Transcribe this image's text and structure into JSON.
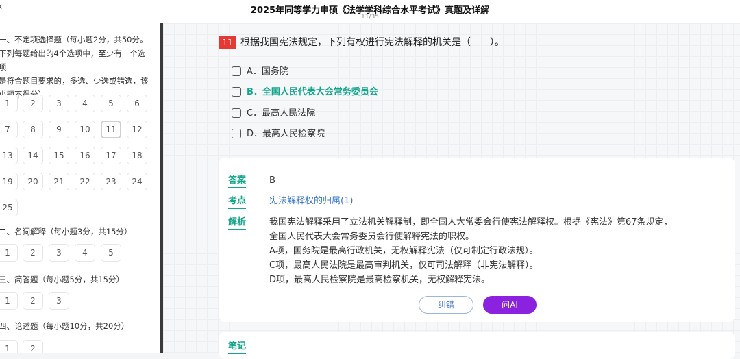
{
  "header": {
    "title": "2025年同等学力申硕《法学学科综合水平考试》真题及详解",
    "page": "11/35",
    "back_icon": "back-icon"
  },
  "sidebar": {
    "sections": [
      {
        "title": "一、不定项选择题（每小题2分，共50分。",
        "desc1": "下列每题给出的4个选项中，至少有一个选项",
        "desc2": "是符合题目要求的，多选、少选或错选，该",
        "desc3": "小题不得分）",
        "items": [
          "1",
          "2",
          "3",
          "4",
          "5",
          "6",
          "7",
          "8",
          "9",
          "10",
          "11",
          "12",
          "13",
          "14",
          "15",
          "16",
          "17",
          "18",
          "19",
          "20",
          "21",
          "22",
          "23",
          "24",
          "25"
        ]
      },
      {
        "title": "二、名词解释（每小题3分，共15分）",
        "items": [
          "1",
          "2",
          "3",
          "4",
          "5"
        ]
      },
      {
        "title": "三、简答题（每小题5分，共15分）",
        "items": [
          "1",
          "2",
          "3"
        ]
      },
      {
        "title": "四、论述题（每小题10分，共20分）",
        "items": [
          "1",
          "2"
        ]
      }
    ],
    "active_item": "11"
  },
  "question": {
    "number": "11",
    "text": "根据我国宪法规定，下列有权进行宪法解释的机关是（　　）。",
    "options": [
      {
        "label": "A．国务院",
        "correct": false
      },
      {
        "label": "B．全国人民代表大会常务委员会",
        "correct": true
      },
      {
        "label": "C．最高人民法院",
        "correct": false
      },
      {
        "label": "D．最高人民检察院",
        "correct": false
      }
    ]
  },
  "answer": {
    "answer_label": "答案",
    "answer_value": "B",
    "point_label": "考点",
    "point_value": "宪法解释权的归属(1)",
    "analysis_label": "解析",
    "analysis_lines": [
      "我国宪法解释采用了立法机关解释制，即全国人大常委会行使宪法解释权。根据《宪法》第67条规定，",
      "全国人民代表大会常务委员会行使解释宪法的职权。",
      "A项，国务院是最高行政机关，无权解释宪法（仅可制定行政法规）。",
      "C项，最高人民法院是最高审判机关，仅可司法解释（非宪法解释）。",
      "D项，最高人民检察院是最高检察机关，无权解释宪法。"
    ],
    "report_button": "纠错",
    "ai_button": "问AI"
  },
  "notes": {
    "label": "笔记"
  },
  "colors": {
    "accent": "#14a58a",
    "badge": "#e53935",
    "ai": "#8a22e0"
  }
}
